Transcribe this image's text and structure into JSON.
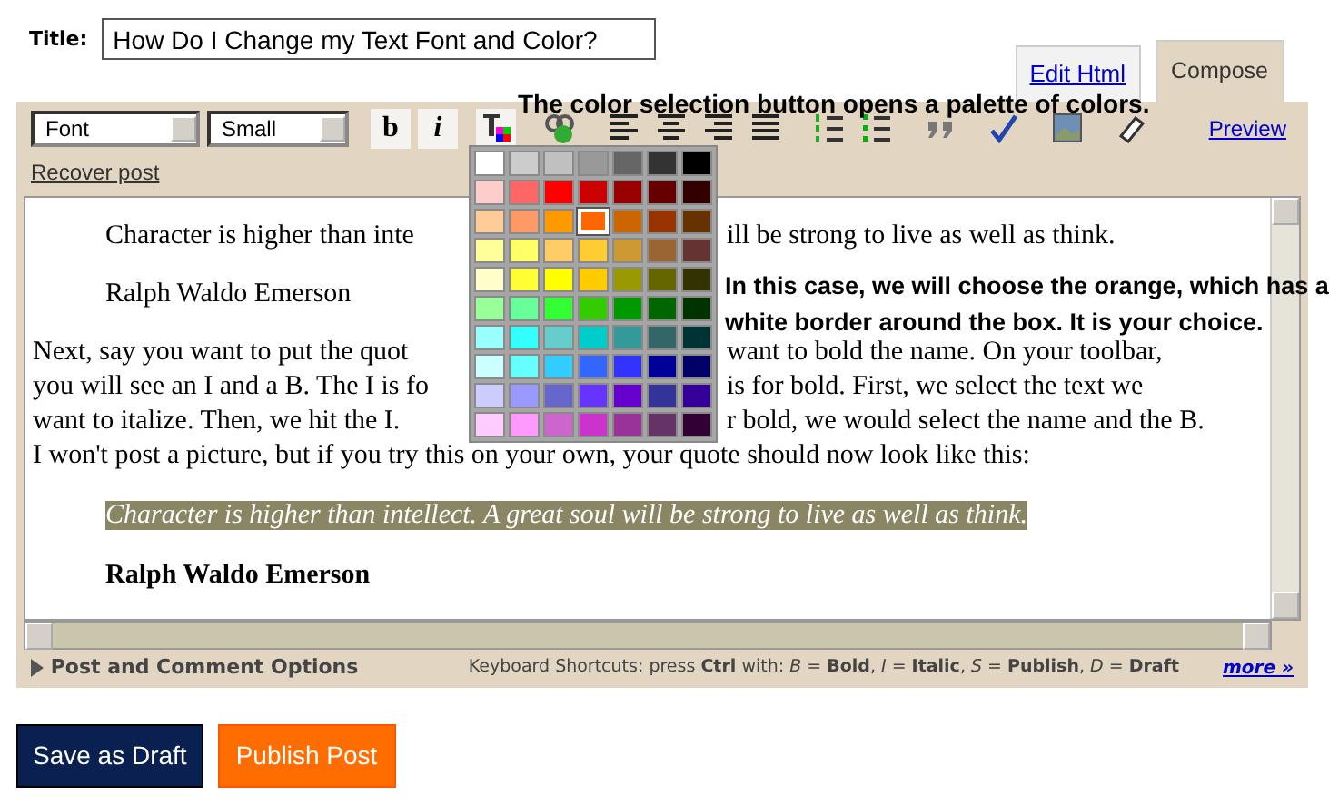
{
  "title_field": {
    "label": "Title:",
    "value": "How Do I Change my Text Font and Color?"
  },
  "tabs": [
    {
      "label": "Edit Html",
      "selected": false
    },
    {
      "label": "Compose",
      "selected": true
    }
  ],
  "toolbar": {
    "font_select": "Font",
    "size_select": "Small",
    "buttons": [
      {
        "kind": "bold",
        "label": "b"
      },
      {
        "kind": "italic",
        "label": "i"
      },
      {
        "kind": "color"
      },
      {
        "kind": "link"
      },
      {
        "kind": "align-left"
      },
      {
        "kind": "align-center"
      },
      {
        "kind": "align-right"
      },
      {
        "kind": "justify"
      },
      {
        "kind": "numbered-list"
      },
      {
        "kind": "bullet-list"
      },
      {
        "kind": "quote"
      },
      {
        "kind": "spellcheck"
      },
      {
        "kind": "image"
      },
      {
        "kind": "eraser"
      }
    ],
    "preview_link": "Preview",
    "recover_link": "Recover post"
  },
  "annotations": [
    "The color selection button opens a palette of colors.",
    "In this case, we will choose the orange, which has a",
    "white border around the box. It is your choice."
  ],
  "editor": {
    "lines": [
      {
        "kind": "indented",
        "left": "Character is higher than inte",
        "right": "ill be strong to live as well as think."
      },
      {
        "kind": "indented",
        "left": "Ralph Waldo Emerson"
      },
      {
        "kind": "normal",
        "left": "Next, say you want to put the quot",
        "right": "want to bold the name. On your toolbar,"
      },
      {
        "kind": "normal",
        "left": "you will see an I and a B. The I is fo",
        "right": "is for bold. First, we select the text we"
      },
      {
        "kind": "normal",
        "left": "want to italize. Then, we hit the I.",
        "right": "r bold, we would select the name and the B."
      },
      {
        "kind": "normal",
        "left": "I won't post a picture, but if you try this on your own, your quote should now look like this:"
      },
      {
        "kind": "highlight",
        "left": "Character is higher than intellect. A great soul will be strong to live as well as think."
      },
      {
        "kind": "signature",
        "left": "Ralph Waldo Emerson"
      }
    ]
  },
  "color_palette": {
    "rows": [
      [
        {
          "color": "#ffffff",
          "selected": false
        },
        {
          "color": "#cccccc",
          "selected": false
        },
        {
          "color": "#c0c0c0",
          "selected": false
        },
        {
          "color": "#999999",
          "selected": false
        },
        {
          "color": "#666666",
          "selected": false
        },
        {
          "color": "#333333",
          "selected": false
        },
        {
          "color": "#000000",
          "selected": false
        }
      ],
      [
        {
          "color": "#ffcccc",
          "selected": false
        },
        {
          "color": "#ff6666",
          "selected": false
        },
        {
          "color": "#ff0000",
          "selected": false
        },
        {
          "color": "#cc0000",
          "selected": false
        },
        {
          "color": "#990000",
          "selected": false
        },
        {
          "color": "#660000",
          "selected": false
        },
        {
          "color": "#330000",
          "selected": false
        }
      ],
      [
        {
          "color": "#ffcc99",
          "selected": false
        },
        {
          "color": "#ff9966",
          "selected": false
        },
        {
          "color": "#ff9900",
          "selected": false
        },
        {
          "color": "#ff6600",
          "selected": true
        },
        {
          "color": "#cc6600",
          "selected": false
        },
        {
          "color": "#993300",
          "selected": false
        },
        {
          "color": "#663300",
          "selected": false
        }
      ],
      [
        {
          "color": "#ffff99",
          "selected": false
        },
        {
          "color": "#ffff66",
          "selected": false
        },
        {
          "color": "#ffcc66",
          "selected": false
        },
        {
          "color": "#ffcc33",
          "selected": false
        },
        {
          "color": "#cc9933",
          "selected": false
        },
        {
          "color": "#996633",
          "selected": false
        },
        {
          "color": "#663333",
          "selected": false
        }
      ],
      [
        {
          "color": "#ffffcc",
          "selected": false
        },
        {
          "color": "#ffff33",
          "selected": false
        },
        {
          "color": "#ffff00",
          "selected": false
        },
        {
          "color": "#ffcc00",
          "selected": false
        },
        {
          "color": "#999900",
          "selected": false
        },
        {
          "color": "#666600",
          "selected": false
        },
        {
          "color": "#333300",
          "selected": false
        }
      ],
      [
        {
          "color": "#99ff99",
          "selected": false
        },
        {
          "color": "#66ff99",
          "selected": false
        },
        {
          "color": "#33ff33",
          "selected": false
        },
        {
          "color": "#33cc00",
          "selected": false
        },
        {
          "color": "#009900",
          "selected": false
        },
        {
          "color": "#006600",
          "selected": false
        },
        {
          "color": "#003300",
          "selected": false
        }
      ],
      [
        {
          "color": "#99ffff",
          "selected": false
        },
        {
          "color": "#33ffff",
          "selected": false
        },
        {
          "color": "#66cccc",
          "selected": false
        },
        {
          "color": "#00cccc",
          "selected": false
        },
        {
          "color": "#339999",
          "selected": false
        },
        {
          "color": "#336666",
          "selected": false
        },
        {
          "color": "#003333",
          "selected": false
        }
      ],
      [
        {
          "color": "#ccffff",
          "selected": false
        },
        {
          "color": "#66ffff",
          "selected": false
        },
        {
          "color": "#33ccff",
          "selected": false
        },
        {
          "color": "#3366ff",
          "selected": false
        },
        {
          "color": "#3333ff",
          "selected": false
        },
        {
          "color": "#000099",
          "selected": false
        },
        {
          "color": "#000066",
          "selected": false
        }
      ],
      [
        {
          "color": "#ccccff",
          "selected": false
        },
        {
          "color": "#9999ff",
          "selected": false
        },
        {
          "color": "#6666cc",
          "selected": false
        },
        {
          "color": "#6633ff",
          "selected": false
        },
        {
          "color": "#6600cc",
          "selected": false
        },
        {
          "color": "#333399",
          "selected": false
        },
        {
          "color": "#330099",
          "selected": false
        }
      ],
      [
        {
          "color": "#ffccff",
          "selected": false
        },
        {
          "color": "#ff99ff",
          "selected": false
        },
        {
          "color": "#cc66cc",
          "selected": false
        },
        {
          "color": "#cc33cc",
          "selected": false
        },
        {
          "color": "#993399",
          "selected": false
        },
        {
          "color": "#663366",
          "selected": false
        },
        {
          "color": "#330033",
          "selected": false
        }
      ]
    ]
  },
  "footer": {
    "options": "Post and Comment Options",
    "shortcuts": "Keyboard Shortcuts: press **Ctrl** with: *B* = **Bold**, *I* = **Italic**, *S* = **Publish**, *D* = **Draft**",
    "more_link": "more »"
  },
  "buttons": [
    {
      "kind": "draft",
      "label": "Save as Draft"
    },
    {
      "kind": "publish",
      "label": "Publish Post"
    }
  ]
}
